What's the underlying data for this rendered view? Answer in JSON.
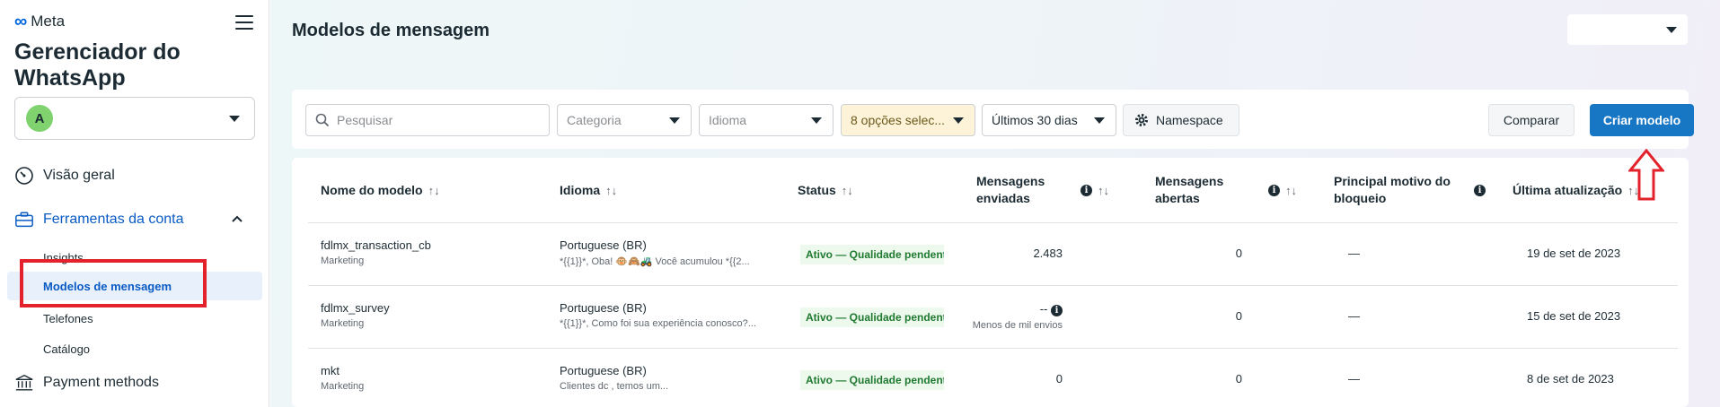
{
  "sidebar": {
    "brand": "Meta",
    "app_title": "Gerenciador do WhatsApp",
    "account_initial": "A",
    "nav": {
      "overview": "Visão geral",
      "account_tools": "Ferramentas da conta",
      "insights": "Insights",
      "templates": "Modelos de mensagem",
      "phones": "Telefones",
      "catalog": "Catálogo",
      "payment": "Payment methods"
    }
  },
  "header": {
    "title": "Modelos de mensagem"
  },
  "toolbar": {
    "search_placeholder": "Pesquisar",
    "category": "Categoria",
    "language": "Idioma",
    "status_filter": "8 opções selec...",
    "date_range": "Últimos 30 dias",
    "namespace": "Namespace",
    "compare": "Comparar",
    "create": "Criar modelo"
  },
  "table": {
    "headers": {
      "name": "Nome do modelo",
      "language": "Idioma",
      "status": "Status",
      "sent": "Mensagens enviadas",
      "opened": "Mensagens abertas",
      "block_reason": "Principal motivo do bloqueio",
      "updated": "Última atualização"
    },
    "sort_glyph": "↑↓",
    "info_glyph": "i",
    "rows": [
      {
        "name": "fdlmx_transaction_cb",
        "category": "Marketing",
        "language": "Portuguese (BR)",
        "preview": "*{{1}}*, Oba! 🐵🙈🚜 Você acumulou *{{2...",
        "status": "Ativo — Qualidade pendente",
        "sent": "2.483",
        "sent_note": "",
        "opened": "0",
        "block_reason": "—",
        "updated": "19 de set de 2023"
      },
      {
        "name": "fdlmx_survey",
        "category": "Marketing",
        "language": "Portuguese (BR)",
        "preview": "*{{1}}*, Como foi sua experiência conosco?...",
        "status": "Ativo — Qualidade pendente",
        "sent": "--",
        "sent_note": "Menos de mil envios",
        "opened": "0",
        "block_reason": "—",
        "updated": "15 de set de 2023"
      },
      {
        "name": "mkt",
        "category": "Marketing",
        "language": "Portuguese (BR)",
        "preview": "Clientes dc                          , temos um...",
        "status": "Ativo — Qualidade pendente",
        "sent": "0",
        "sent_note": "",
        "opened": "0",
        "block_reason": "—",
        "updated": "8 de set de 2023"
      }
    ]
  },
  "colors": {
    "primary_blue": "#1877c5",
    "active_nav_text": "#0a5bc4",
    "annotation_red": "#e3222b",
    "status_green": "#1f7a30"
  },
  "icons": [
    "hamburger-icon",
    "speedometer-icon",
    "briefcase-icon",
    "chevron-up-icon",
    "bank-icon",
    "search-icon",
    "gear-icon",
    "chevron-down-icon",
    "info-icon",
    "sort-icon"
  ]
}
